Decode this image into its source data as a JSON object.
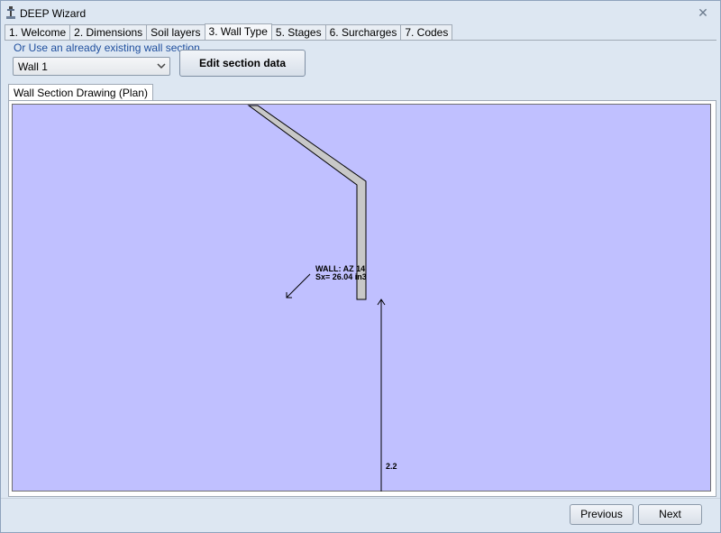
{
  "window": {
    "title": "DEEP Wizard",
    "close_glyph": "✕"
  },
  "tabs": [
    {
      "label": "1. Welcome"
    },
    {
      "label": "2. Dimensions"
    },
    {
      "label": "Soil layers"
    },
    {
      "label": "3. Wall Type",
      "active": true
    },
    {
      "label": "5. Stages"
    },
    {
      "label": "6. Surcharges"
    },
    {
      "label": "7. Codes"
    }
  ],
  "section_picker": {
    "hint": "Or Use an already existing wall section",
    "selected": "Wall 1",
    "edit_button": "Edit section data"
  },
  "drawing": {
    "tab_label": "Wall Section Drawing (Plan)",
    "wall_name": "WALL: AZ 14",
    "wall_modulus": "Sx= 26.04 in3",
    "dimension_value": "2.2",
    "background_color": "#c0c0ff",
    "wall_fill_color": "#c8c8c8"
  },
  "footer": {
    "previous": "Previous",
    "next": "Next"
  }
}
